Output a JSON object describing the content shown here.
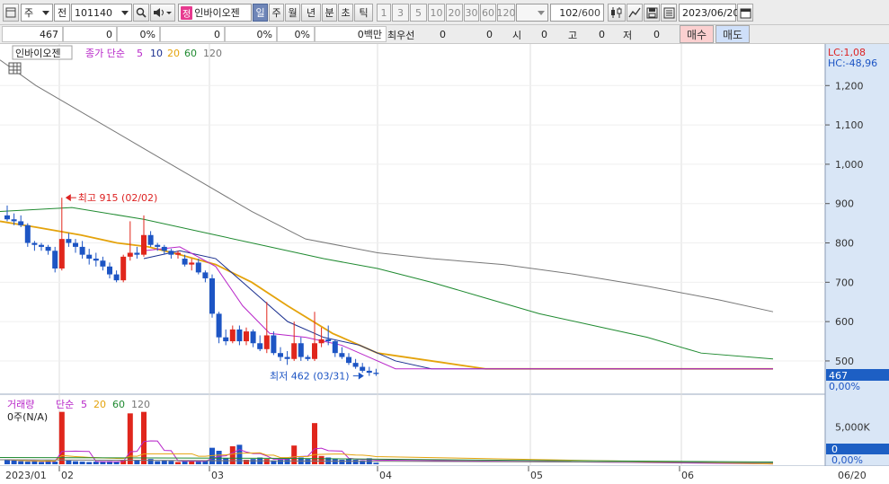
{
  "toolbar": {
    "market": "주",
    "whole": "전",
    "code": "101140",
    "stock_tag": "정",
    "stock_name": "인바이오젠",
    "periods": [
      "일",
      "주",
      "월",
      "년",
      "분",
      "초",
      "틱"
    ],
    "active_period": "일",
    "intervals": [
      "1",
      "3",
      "5",
      "10",
      "20",
      "30",
      "60",
      "120"
    ],
    "count": "102",
    "count_max": "/600",
    "date": "2023/06/20"
  },
  "quote": {
    "price": "467",
    "change": "0",
    "rate": "0%",
    "volume": "0",
    "vol_rate": "0%",
    "turnover_rate": "0%",
    "amount": "0백만",
    "best_label": "최우선",
    "best_ask": "0",
    "best_bid": "0",
    "open_label": "시",
    "open": "0",
    "high_label": "고",
    "high": "0",
    "low_label": "저",
    "low": "0",
    "buy_label": "매수",
    "sell_label": "매도"
  },
  "legend_price": {
    "name": "인바이오젠",
    "ma_label": "종가 단순",
    "ma_periods": [
      "5",
      "10",
      "20",
      "60",
      "120"
    ],
    "ma_colors": [
      "#b826c9",
      "#1a2f8f",
      "#e4a30c",
      "#1f8a30",
      "#777777"
    ]
  },
  "legend_volume": {
    "name": "거래량",
    "ma_label": "단순",
    "ma_periods": [
      "5",
      "20",
      "60",
      "120"
    ],
    "ma_colors": [
      "#b826c9",
      "#e4a30c",
      "#1f8a30",
      "#777777"
    ],
    "status": "0주(N/A)"
  },
  "axis": {
    "lc": "LC:1,08",
    "hc": "HC:-48,96",
    "price_ticks": [
      "1,200",
      "1,100",
      "1,000",
      "900",
      "800",
      "700",
      "600",
      "500"
    ],
    "price_current": "467",
    "price_current_pct": "0,00%",
    "volume_ticks": [
      "5,000K"
    ],
    "volume_current": "0",
    "volume_current_pct": "0,00%",
    "dates": [
      "2023/01",
      "02",
      "03",
      "04",
      "05",
      "06",
      "06/20"
    ]
  },
  "annotations": {
    "high": "최고 915 (02/02)",
    "low": "최저 462 (03/31)"
  },
  "colors": {
    "up": "#e0261c",
    "down": "#1d55c4",
    "axis_current_bg": "#1d5fc4"
  },
  "chart_data": {
    "type": "candlestick",
    "ylim": [
      420,
      1260
    ],
    "candles": [
      [
        870,
        895,
        855,
        860
      ],
      [
        860,
        875,
        845,
        855
      ],
      [
        855,
        870,
        840,
        845
      ],
      [
        845,
        850,
        790,
        800
      ],
      [
        800,
        805,
        780,
        795
      ],
      [
        795,
        800,
        780,
        790
      ],
      [
        790,
        795,
        770,
        780
      ],
      [
        780,
        790,
        725,
        735
      ],
      [
        735,
        915,
        730,
        810
      ],
      [
        810,
        825,
        790,
        800
      ],
      [
        800,
        810,
        775,
        790
      ],
      [
        790,
        805,
        760,
        770
      ],
      [
        770,
        785,
        745,
        760
      ],
      [
        760,
        775,
        740,
        755
      ],
      [
        755,
        765,
        730,
        740
      ],
      [
        740,
        750,
        710,
        720
      ],
      [
        720,
        730,
        700,
        705
      ],
      [
        705,
        770,
        700,
        765
      ],
      [
        765,
        855,
        755,
        775
      ],
      [
        775,
        790,
        760,
        770
      ],
      [
        770,
        870,
        765,
        820
      ],
      [
        820,
        830,
        790,
        795
      ],
      [
        795,
        800,
        780,
        790
      ],
      [
        790,
        795,
        770,
        780
      ],
      [
        780,
        785,
        760,
        770
      ],
      [
        770,
        780,
        760,
        775
      ],
      [
        760,
        770,
        740,
        745
      ],
      [
        745,
        760,
        730,
        750
      ],
      [
        750,
        760,
        720,
        725
      ],
      [
        725,
        730,
        700,
        710
      ],
      [
        710,
        720,
        610,
        620
      ],
      [
        620,
        625,
        545,
        560
      ],
      [
        560,
        580,
        540,
        550
      ],
      [
        550,
        590,
        545,
        580
      ],
      [
        580,
        590,
        540,
        550
      ],
      [
        550,
        585,
        540,
        575
      ],
      [
        575,
        580,
        535,
        545
      ],
      [
        545,
        565,
        525,
        530
      ],
      [
        530,
        650,
        520,
        565
      ],
      [
        565,
        575,
        515,
        520
      ],
      [
        520,
        535,
        500,
        510
      ],
      [
        510,
        525,
        490,
        505
      ],
      [
        505,
        600,
        500,
        545
      ],
      [
        545,
        560,
        500,
        510
      ],
      [
        510,
        515,
        500,
        505
      ],
      [
        505,
        625,
        500,
        545
      ],
      [
        545,
        585,
        535,
        555
      ],
      [
        555,
        590,
        540,
        550
      ],
      [
        550,
        555,
        510,
        520
      ],
      [
        520,
        535,
        505,
        510
      ],
      [
        510,
        520,
        490,
        495
      ],
      [
        495,
        505,
        480,
        485
      ],
      [
        485,
        495,
        470,
        475
      ],
      [
        475,
        485,
        462,
        470
      ],
      [
        470,
        480,
        462,
        467
      ]
    ],
    "volume_ylim": [
      0,
      7200
    ],
    "volume": [
      600,
      500,
      400,
      350,
      400,
      300,
      500,
      350,
      7000,
      500,
      400,
      350,
      300,
      350,
      300,
      400,
      300,
      500,
      6800,
      600,
      7000,
      700,
      400,
      500,
      450,
      300,
      400,
      450,
      350,
      500,
      2200,
      1800,
      800,
      2400,
      2600,
      600,
      700,
      900,
      700,
      500,
      600,
      700,
      2500,
      900,
      700,
      5500,
      1100,
      900,
      700,
      600,
      700,
      600,
      500,
      800,
      200
    ],
    "ma120": [
      [
        -1,
        1265
      ],
      [
        40,
        1200
      ],
      [
        100,
        1120
      ],
      [
        160,
        1040
      ],
      [
        220,
        960
      ],
      [
        280,
        880
      ],
      [
        340,
        810
      ],
      [
        420,
        775
      ],
      [
        480,
        760
      ],
      [
        560,
        745
      ],
      [
        640,
        720
      ],
      [
        720,
        690
      ],
      [
        800,
        655
      ],
      [
        860,
        625
      ]
    ],
    "ma60": [
      [
        -1,
        880
      ],
      [
        80,
        890
      ],
      [
        160,
        860
      ],
      [
        240,
        820
      ],
      [
        300,
        790
      ],
      [
        360,
        760
      ],
      [
        420,
        735
      ],
      [
        480,
        700
      ],
      [
        540,
        660
      ],
      [
        600,
        620
      ],
      [
        660,
        590
      ],
      [
        720,
        560
      ],
      [
        780,
        520
      ],
      [
        860,
        505
      ]
    ],
    "ma20": [
      [
        -1,
        855
      ],
      [
        40,
        840
      ],
      [
        90,
        820
      ],
      [
        130,
        800
      ],
      [
        165,
        790
      ],
      [
        200,
        770
      ],
      [
        240,
        745
      ],
      [
        280,
        700
      ],
      [
        320,
        640
      ],
      [
        370,
        570
      ],
      [
        420,
        520
      ],
      [
        480,
        500
      ],
      [
        540,
        480
      ],
      [
        860,
        480
      ]
    ],
    "ma10": [
      [
        160,
        760
      ],
      [
        200,
        780
      ],
      [
        240,
        760
      ],
      [
        280,
        680
      ],
      [
        320,
        600
      ],
      [
        360,
        560
      ],
      [
        400,
        540
      ],
      [
        440,
        500
      ],
      [
        480,
        480
      ],
      [
        860,
        480
      ]
    ],
    "ma5": [
      [
        160,
        780
      ],
      [
        200,
        790
      ],
      [
        240,
        740
      ],
      [
        270,
        640
      ],
      [
        300,
        570
      ],
      [
        340,
        560
      ],
      [
        380,
        540
      ],
      [
        410,
        510
      ],
      [
        440,
        480
      ],
      [
        860,
        480
      ]
    ]
  }
}
